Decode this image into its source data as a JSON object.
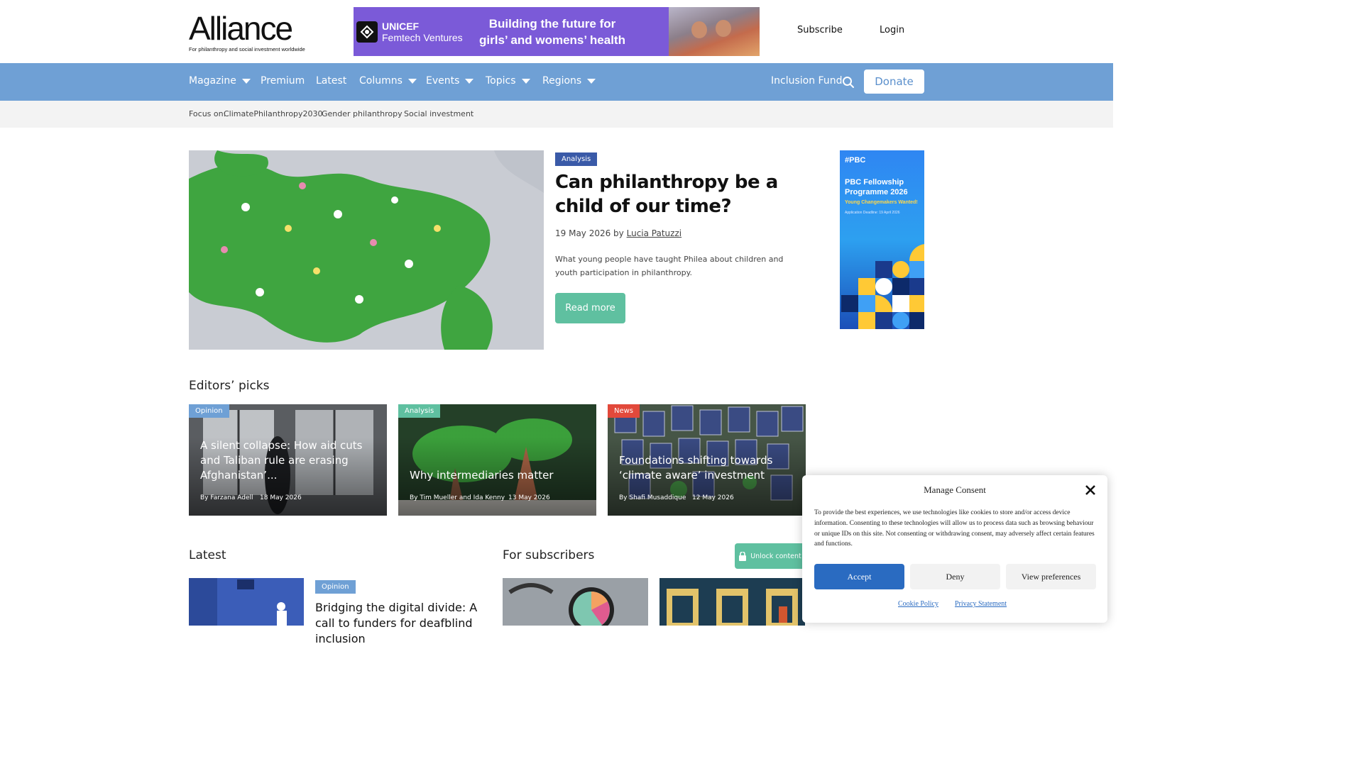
{
  "header": {
    "logo_word": "Alliance",
    "logo_tagline": "For philanthropy and social investment worldwide",
    "banner": {
      "org_line1": "UNICEF",
      "org_line2": "Femtech Ventures",
      "headline": "Building the future for girls’ and womens’ health"
    },
    "subscribe": "Subscribe",
    "login": "Login"
  },
  "nav": {
    "items": [
      {
        "label": "Magazine",
        "dropdown": true
      },
      {
        "label": "Premium",
        "dropdown": false
      },
      {
        "label": "Latest",
        "dropdown": false
      },
      {
        "label": "Columns",
        "dropdown": true
      },
      {
        "label": "Events",
        "dropdown": true
      },
      {
        "label": "Topics",
        "dropdown": true
      },
      {
        "label": "Regions",
        "dropdown": true
      }
    ],
    "inclusion_fund": "Inclusion Fund",
    "search_icon": "search-icon",
    "donate": "Donate",
    "bg_color": "#6fa0d5"
  },
  "focus": {
    "label": "Focus on:",
    "items": [
      "ClimatePhilanthropy2030",
      "Gender philanthropy",
      "Social investment"
    ]
  },
  "hero": {
    "tag": "Analysis",
    "title": "Can philanthropy be a child of our time?",
    "date": "19 May 2026 by",
    "author": "Lucia Patuzzi",
    "description": "What young people have taught Philea about children and youth participation in philanthropy.",
    "read_more": "Read more"
  },
  "side_ad": {
    "logo": "#PBC",
    "title": "PBC Fellowship Programme 2026",
    "subtitle": "Young Changemakers Wanted!",
    "deadline": "Application Deadline: 19 April 2026"
  },
  "editors_picks": {
    "title": "Editors’ picks",
    "cards": [
      {
        "tag": "Opinion",
        "title": "A silent collapse: How aid cuts and Taliban rule are erasing Afghanistan’...",
        "by": "By Farzana Adell",
        "date": "18 May 2026"
      },
      {
        "tag": "Analysis",
        "title": "Why intermediaries matter",
        "by": "By Tim Mueller and Ida Kenny",
        "date": "13 May 2026"
      },
      {
        "tag": "News",
        "title": "Foundations shifting towards ‘climate aware’ investment",
        "by": "By Shafi Musaddique",
        "date": "12 May 2026"
      }
    ]
  },
  "latest": {
    "title": "Latest",
    "item": {
      "tag": "Opinion",
      "title": "Bridging the digital divide: A call to funders for deafblind inclusion"
    }
  },
  "subscribers": {
    "title": "For subscribers",
    "unlock": "Unlock content"
  },
  "consent": {
    "title": "Manage Consent",
    "text": "To provide the best experiences, we use technologies like cookies to store and/or access device information. Consenting to these technologies will allow us to process data such as browsing behaviour or unique IDs on this site. Not consenting or withdrawing consent, may adversely affect certain features and functions.",
    "accept": "Accept",
    "deny": "Deny",
    "preferences": "View preferences",
    "cookie_policy": "Cookie Policy",
    "privacy": "Privacy Statement"
  }
}
